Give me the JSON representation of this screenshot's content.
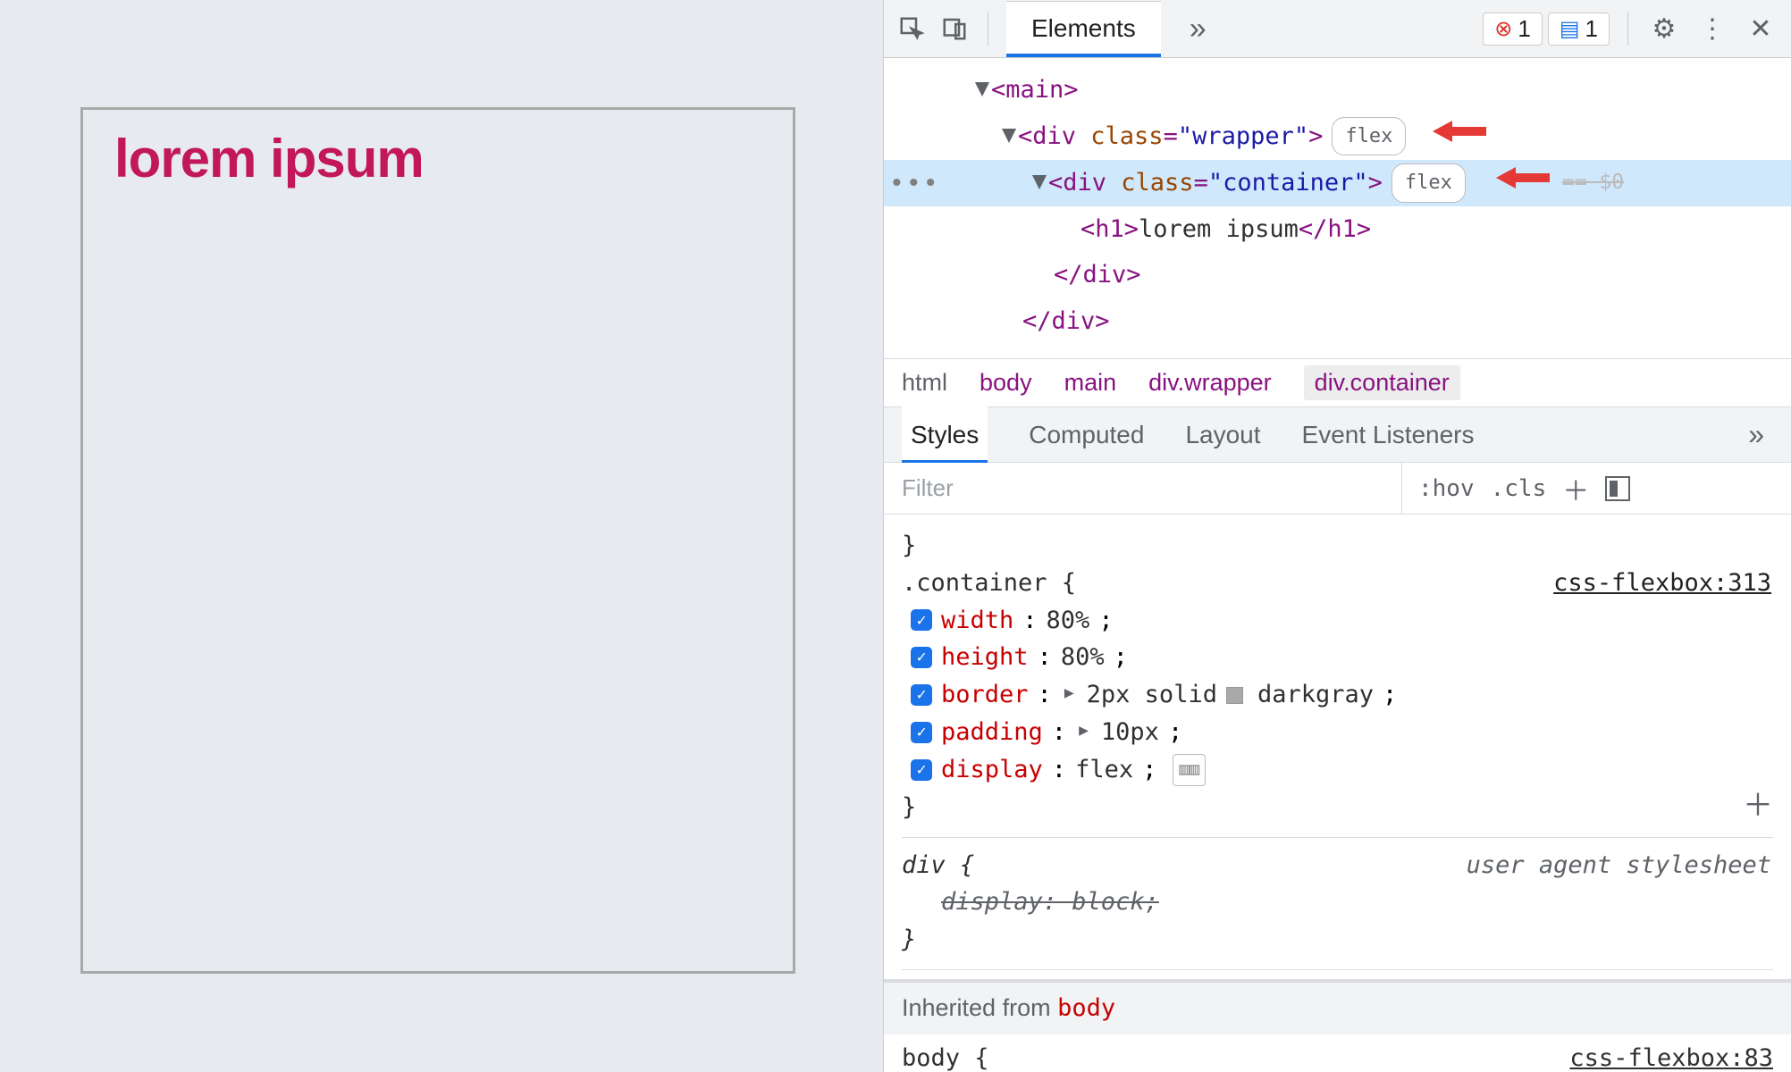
{
  "page": {
    "heading": "lorem ipsum"
  },
  "toolbar": {
    "tab_elements": "Elements",
    "errors_count": "1",
    "messages_count": "1"
  },
  "dom": {
    "main_open": "<main>",
    "wrapper_open_pre": "<div ",
    "wrapper_class_attr": "class",
    "wrapper_class_val": "\"wrapper\"",
    "wrapper_open_post": ">",
    "container_open_pre": "<div ",
    "container_class_attr": "class",
    "container_class_val": "\"container\"",
    "container_open_post": ">",
    "h1_open": "<h1>",
    "h1_text": "lorem ipsum",
    "h1_close": "</h1>",
    "div_close1": "</div>",
    "div_close2": "</div>",
    "flex_badge": "flex",
    "eq0": "== $0"
  },
  "breadcrumb": [
    "html",
    "body",
    "main",
    "div.wrapper",
    "div.container"
  ],
  "subtabs": {
    "styles": "Styles",
    "computed": "Computed",
    "layout": "Layout",
    "listeners": "Event Listeners"
  },
  "filter": {
    "placeholder": "Filter",
    "hov": ":hov",
    "cls": ".cls"
  },
  "rules": {
    "container_selector": ".container {",
    "container_src": "css-flexbox:313",
    "decls": [
      {
        "prop": "width",
        "val": "80%"
      },
      {
        "prop": "height",
        "val": "80%"
      },
      {
        "prop": "border",
        "val_pre": "2px solid ",
        "val_color": "darkgray",
        "expand": true,
        "swatch": true
      },
      {
        "prop": "padding",
        "val": "10px",
        "expand": true
      },
      {
        "prop": "display",
        "val": "flex",
        "flexglyph": true
      }
    ],
    "div_selector": "div {",
    "ua_label": "user agent stylesheet",
    "div_decl_struck": "display: block;",
    "inherited_label": "Inherited from ",
    "inherited_from": "body",
    "body_selector": "body {",
    "body_src": "css-flexbox:83"
  }
}
